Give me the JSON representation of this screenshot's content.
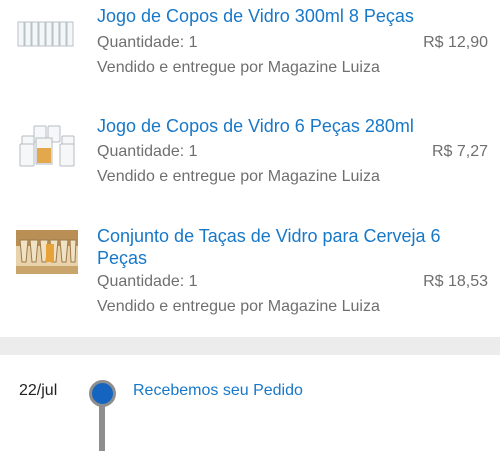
{
  "items": [
    {
      "title": "Jogo de Copos de Vidro 300ml 8 Peças",
      "quantity": "Quantidade: 1",
      "price": "R$ 12,90",
      "seller": "Vendido e entregue por Magazine Luiza",
      "image_icon": "glass-set-8-icon"
    },
    {
      "title": "Jogo de Copos de Vidro 6 Peças 280ml",
      "quantity": "Quantidade: 1",
      "price": "R$ 7,27",
      "seller": "Vendido e entregue por Magazine Luiza",
      "image_icon": "glass-set-6-icon"
    },
    {
      "title": "Conjunto de Taças de Vidro para Cerveja 6 Peças",
      "quantity": "Quantidade: 1",
      "price": "R$ 18,53",
      "seller": "Vendido e entregue por Magazine Luiza",
      "image_icon": "beer-glasses-icon"
    }
  ],
  "timeline": {
    "date": "22/jul",
    "status": "Recebemos seu Pedido"
  },
  "colors": {
    "link": "#1878c8",
    "muted_text": "#6f6f6f",
    "divider": "#ececec",
    "timeline_dot": "#1565c0"
  }
}
